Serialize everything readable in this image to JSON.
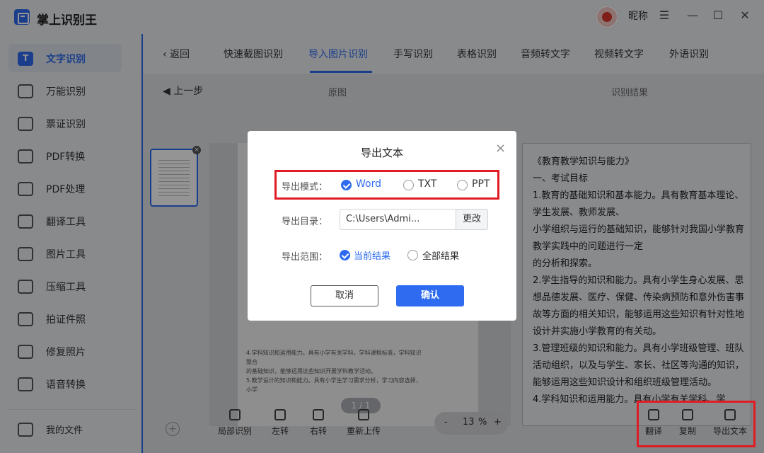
{
  "app": {
    "title": "掌上识别王",
    "nickname": "昵称"
  },
  "window_controls": {
    "menu": "☰",
    "minimize": "—",
    "maximize": "☐",
    "close": "✕"
  },
  "sidebar": {
    "items": [
      {
        "label": "文字识别",
        "icon": "text-recognition-icon",
        "active": true
      },
      {
        "label": "万能识别",
        "icon": "universal-scan-icon"
      },
      {
        "label": "票证识别",
        "icon": "ticket-icon"
      },
      {
        "label": "PDF转换",
        "icon": "pdf-convert-icon"
      },
      {
        "label": "PDF处理",
        "icon": "pdf-process-icon"
      },
      {
        "label": "翻译工具",
        "icon": "translate-icon"
      },
      {
        "label": "图片工具",
        "icon": "image-icon"
      },
      {
        "label": "压缩工具",
        "icon": "compress-icon"
      },
      {
        "label": "拍证件照",
        "icon": "id-photo-icon"
      },
      {
        "label": "修复照片",
        "icon": "repair-photo-icon"
      },
      {
        "label": "语音转换",
        "icon": "voice-icon"
      }
    ],
    "my_files": "我的文件"
  },
  "tabs": {
    "back": "返回",
    "items": [
      "快速截图识别",
      "导入图片识别",
      "手写识别",
      "表格识别",
      "音频转文字",
      "视频转文字",
      "外语识别"
    ],
    "active_index": 1
  },
  "workspace": {
    "prev_step": "上一步",
    "original_title": "原图",
    "result_title": "识别结果",
    "page_indicator": "1 / 1",
    "doc_lines": [
      "4.学科知识和运用能力。具有小学有关学科，学科课程标准，学科知识",
      "整合",
      "的基础知识，能够运用这些知识开展学科教学活动。",
      "5.教学设计的知识和能力。具有小学生学习需求分析，学习内容选择，",
      "小学"
    ],
    "result_text": "《教育教学知识与能力》\n一、考试目标\n1.教育的基础知识和基本能力。具有教育基本理论、学生发展、教师发展、\n小学组织与运行的基础知识，能够针对我国小学教育教学实践中的问题进行一定\n的分析和探索。\n2.学生指导的知识和能力。具有小学生身心发展、思想品德发展、医疗、保健、传染病预防和意外伤害事故等方面的相关知识，能够运用这些知识有针对性地设计并实施小学教育的有关动。\n3.管理班级的知识和能力。具有小学班级管理、班队活动组织，以及与学生、家长、社区等沟通的知识，能够运用这些知识设计和组织班级管理活动。\n4.学科知识和运用能力。具有小学有关学科、学"
  },
  "toolbar": {
    "tools": [
      "局部识别",
      "左转",
      "右转",
      "重新上传"
    ],
    "zoom": {
      "minus": "-",
      "value": "13",
      "unit": "%",
      "plus": "+"
    },
    "actions": [
      "翻译",
      "复制",
      "导出文本"
    ]
  },
  "dialog": {
    "title": "导出文本",
    "mode_label": "导出模式：",
    "mode_options": [
      "Word",
      "TXT",
      "PPT"
    ],
    "mode_selected": "Word",
    "dir_label": "导出目录：",
    "dir_value": "C:\\Users\\Admi...",
    "change_label": "更改",
    "range_label": "导出范围：",
    "range_options": [
      "当前结果",
      "全部结果"
    ],
    "range_selected": "当前结果",
    "cancel": "取消",
    "confirm": "确认"
  },
  "colors": {
    "accent": "#2e6bf0",
    "highlight": "#e01b24"
  }
}
